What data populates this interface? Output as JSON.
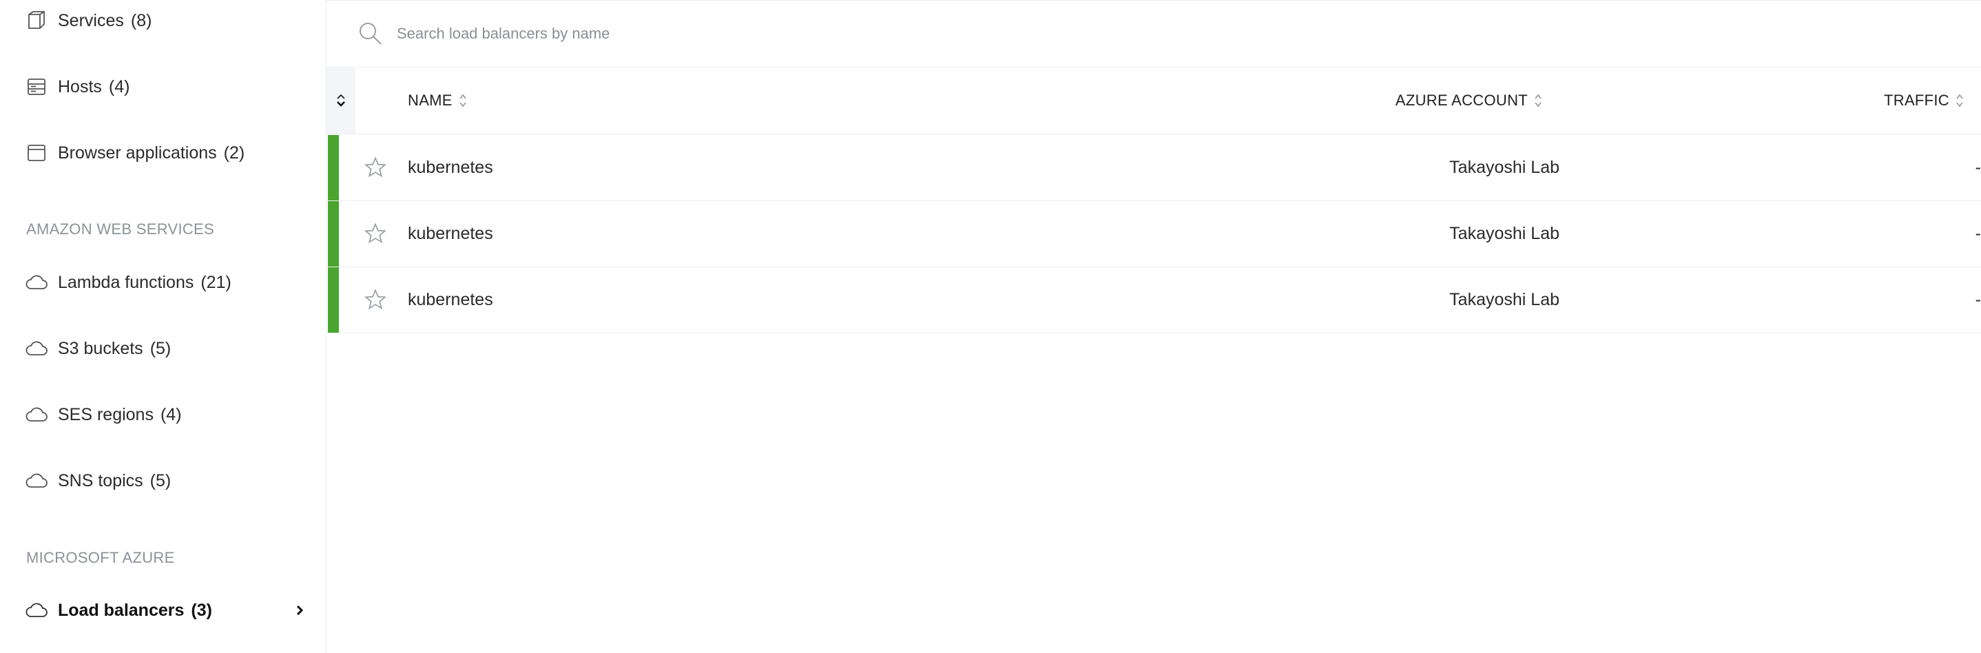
{
  "sidebar": {
    "items_top": [
      {
        "label": "Services",
        "count": "(8)",
        "icon": "cube-icon"
      },
      {
        "label": "Hosts",
        "count": "(4)",
        "icon": "server-icon"
      },
      {
        "label": "Browser applications",
        "count": "(2)",
        "icon": "browser-window-icon"
      }
    ],
    "aws_title": "AMAZON WEB SERVICES",
    "aws_items": [
      {
        "label": "Lambda functions",
        "count": "(21)",
        "icon": "cloud-icon"
      },
      {
        "label": "S3 buckets",
        "count": "(5)",
        "icon": "cloud-icon"
      },
      {
        "label": "SES regions",
        "count": "(4)",
        "icon": "cloud-icon"
      },
      {
        "label": "SNS topics",
        "count": "(5)",
        "icon": "cloud-icon"
      }
    ],
    "azure_title": "MICROSOFT AZURE",
    "azure_items": [
      {
        "label": "Load balancers",
        "count": "(3)",
        "icon": "cloud-icon",
        "active": true
      }
    ]
  },
  "search": {
    "placeholder": "Search load balancers by name",
    "value": ""
  },
  "table": {
    "columns": {
      "name": "NAME",
      "account": "AZURE ACCOUNT",
      "traffic": "TRAFFIC"
    },
    "rows": [
      {
        "name": "kubernetes",
        "account": "Takayoshi Lab",
        "traffic": "-",
        "status": "healthy"
      },
      {
        "name": "kubernetes",
        "account": "Takayoshi Lab",
        "traffic": "-",
        "status": "healthy"
      },
      {
        "name": "kubernetes",
        "account": "Takayoshi Lab",
        "traffic": "-",
        "status": "healthy"
      }
    ]
  },
  "colors": {
    "status_healthy": "#4aa530",
    "section_title": "#8d9297",
    "border": "#eceef0"
  }
}
